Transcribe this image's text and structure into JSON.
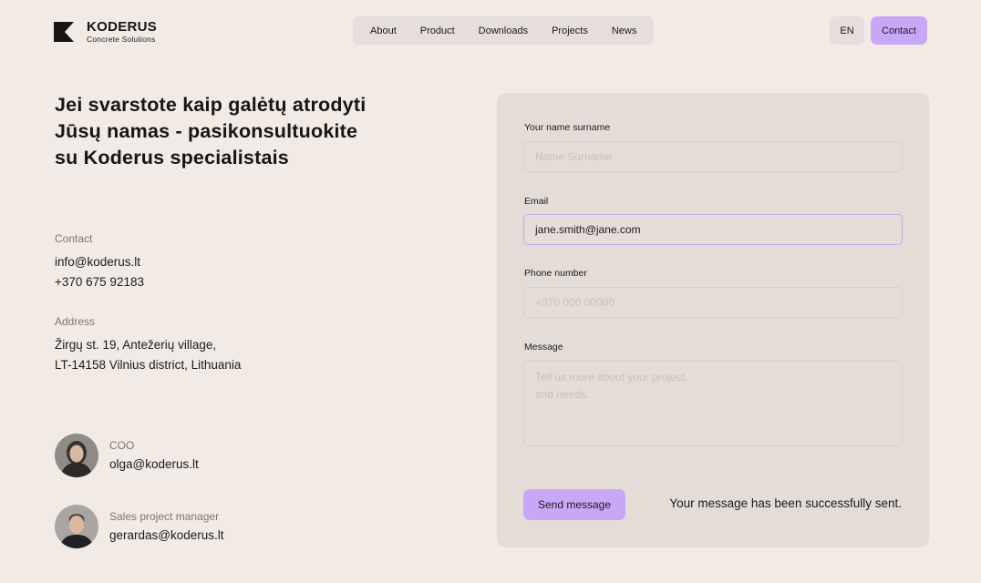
{
  "brand": {
    "name": "KODERUS",
    "tagline": "Concrete Solutions",
    "color": "#151515"
  },
  "nav": {
    "items": [
      "About",
      "Product",
      "Downloads",
      "Projects",
      "News"
    ]
  },
  "header": {
    "lang": "EN",
    "contact": "Contact",
    "accent": "#c9a7f7"
  },
  "hero": {
    "lines": [
      "Jei svarstote kaip galėtų atrodyti",
      "Jūsų namas - pasikonsultuokite",
      "su Koderus specialistais"
    ]
  },
  "contact": {
    "label": "Contact",
    "email": "info@koderus.lt",
    "phone": "+370 675 92183"
  },
  "address": {
    "label": "Address",
    "line1": "Žirgų st. 19, Antežerių village,",
    "line2": "LT-14158 Vilnius district, Lithuania"
  },
  "people": [
    {
      "role": "COO",
      "email": "olga@koderus.lt"
    },
    {
      "role": "Sales project manager",
      "email": "gerardas@koderus.lt"
    }
  ],
  "form": {
    "name": {
      "label": "Your name surname",
      "placeholder": "Name Surname",
      "value": ""
    },
    "email": {
      "label": "Email",
      "placeholder": "",
      "value": "jane.smith@jane.com"
    },
    "phone": {
      "label": "Phone number",
      "placeholder": "+370 000 00000",
      "value": ""
    },
    "message": {
      "label": "Message",
      "placeholder": "Tell us more about your project\nand needs.",
      "value": ""
    },
    "submit": "Send message",
    "status": "Your message has been successfully sent."
  }
}
